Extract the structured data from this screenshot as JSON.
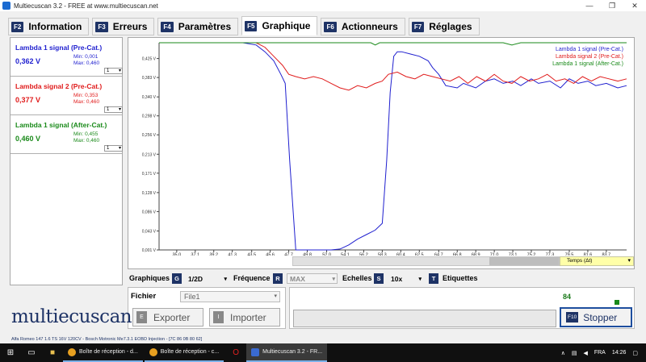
{
  "window": {
    "title": "Multiecuscan 3.2 - FREE at www.multiecuscan.net",
    "controls": [
      "—",
      "❐",
      "✕"
    ]
  },
  "tabs": [
    {
      "key": "F2",
      "label": "Information",
      "active": false
    },
    {
      "key": "F3",
      "label": "Erreurs",
      "active": false
    },
    {
      "key": "F4",
      "label": "Paramètres",
      "active": false
    },
    {
      "key": "F5",
      "label": "Graphique",
      "active": true
    },
    {
      "key": "F6",
      "label": "Actionneurs",
      "active": false
    },
    {
      "key": "F7",
      "label": "Réglages",
      "active": false
    }
  ],
  "signals": [
    {
      "name": "Lambda 1 signal (Pre-Cat.)",
      "value": "0,362 V",
      "min": "Min: 0,001",
      "max": "Max: 0,460",
      "scale": "1",
      "color": "#1f1fcf"
    },
    {
      "name": "Lambda signal 2 (Pre-Cat.)",
      "value": "0,377 V",
      "min": "Min: 0,353",
      "max": "Max: 0,460",
      "scale": "1",
      "color": "#e01b1b"
    },
    {
      "name": "Lambda 1 signal (After-Cat.)",
      "value": "0,460 V",
      "min": "Min: 0,455",
      "max": "Max: 0,460",
      "scale": "1",
      "color": "#1a8a1a"
    }
  ],
  "chart_data": {
    "type": "line",
    "ylim": [
      0.001,
      0.46
    ],
    "xlim": [
      33.0,
      86.0
    ],
    "y_ticks": [
      "0,001 V",
      "0,043 V",
      "0,086 V",
      "0,128 V",
      "0,171 V",
      "0,213 V",
      "0,256 V",
      "0,298 V",
      "0,340 V",
      "0,383 V",
      "0,425 V"
    ],
    "y_tick_values": [
      0.001,
      0.043,
      0.086,
      0.128,
      0.171,
      0.213,
      0.256,
      0.298,
      0.34,
      0.383,
      0.425
    ],
    "x_ticks": [
      "35,0",
      "37,1",
      "39,2",
      "41,3",
      "43,5",
      "45,6",
      "47,7",
      "49,8",
      "52,0",
      "54,1",
      "56,2",
      "58,3",
      "60,4",
      "62,5",
      "64,7",
      "66,8",
      "68,9",
      "71,0",
      "73,1",
      "75,2",
      "77,3",
      "79,5",
      "81,6",
      "83,7"
    ],
    "x_tick_values": [
      35.0,
      37.1,
      39.2,
      41.3,
      43.5,
      45.6,
      47.7,
      49.8,
      52.0,
      54.1,
      56.2,
      58.3,
      60.4,
      62.5,
      64.7,
      66.8,
      68.9,
      71.0,
      73.1,
      75.2,
      77.3,
      79.5,
      81.6,
      83.7
    ],
    "x_axis_menu": "Temps (Δt)",
    "legend_position": "top-right",
    "grid": false,
    "series": [
      {
        "name": "Lambda 1 signal (Pre-Cat.)",
        "color": "#1f1fcf",
        "x": [
          33.0,
          35.0,
          37.0,
          39.0,
          41.0,
          42.5,
          44.0,
          45.0,
          46.0,
          46.8,
          47.3,
          47.8,
          48.5,
          49.5,
          50.5,
          51.5,
          52.5,
          53.5,
          54.5,
          55.5,
          56.5,
          57.5,
          58.3,
          58.8,
          59.2,
          59.6,
          60.0,
          60.5,
          61.5,
          62.5,
          63.5,
          64.0,
          64.7,
          65.5,
          66.8,
          67.5,
          68.9,
          70.0,
          71.0,
          72.0,
          73.1,
          74.0,
          75.2,
          76.0,
          77.3,
          78.5,
          79.5,
          80.5,
          81.6,
          82.5,
          83.7,
          85.0,
          86.0
        ],
        "y": [
          0.46,
          0.46,
          0.46,
          0.46,
          0.46,
          0.46,
          0.455,
          0.44,
          0.42,
          0.39,
          0.37,
          0.2,
          0.001,
          0.001,
          0.001,
          0.001,
          0.001,
          0.003,
          0.012,
          0.025,
          0.035,
          0.045,
          0.06,
          0.2,
          0.35,
          0.43,
          0.44,
          0.44,
          0.435,
          0.43,
          0.42,
          0.405,
          0.39,
          0.365,
          0.36,
          0.37,
          0.36,
          0.375,
          0.38,
          0.37,
          0.375,
          0.365,
          0.38,
          0.37,
          0.375,
          0.36,
          0.38,
          0.37,
          0.375,
          0.365,
          0.37,
          0.36,
          0.365
        ]
      },
      {
        "name": "Lambda signal 2 (Pre-Cat.)",
        "color": "#e01b1b",
        "x": [
          33.0,
          35.0,
          37.0,
          39.0,
          41.0,
          42.5,
          44.0,
          45.0,
          46.0,
          47.0,
          47.7,
          48.5,
          49.5,
          50.5,
          51.5,
          52.5,
          53.5,
          54.5,
          55.5,
          56.5,
          57.5,
          58.3,
          59.0,
          60.0,
          61.0,
          62.0,
          63.0,
          64.0,
          65.0,
          66.0,
          67.0,
          68.0,
          69.0,
          70.0,
          71.0,
          72.0,
          73.0,
          74.0,
          75.0,
          76.0,
          77.0,
          78.0,
          79.0,
          80.0,
          81.0,
          82.0,
          83.0,
          84.0,
          85.0,
          86.0
        ],
        "y": [
          0.46,
          0.46,
          0.46,
          0.46,
          0.46,
          0.46,
          0.46,
          0.45,
          0.43,
          0.41,
          0.39,
          0.385,
          0.38,
          0.385,
          0.38,
          0.37,
          0.36,
          0.355,
          0.365,
          0.36,
          0.37,
          0.375,
          0.39,
          0.395,
          0.385,
          0.38,
          0.39,
          0.385,
          0.38,
          0.375,
          0.385,
          0.37,
          0.385,
          0.375,
          0.39,
          0.375,
          0.37,
          0.385,
          0.375,
          0.38,
          0.39,
          0.375,
          0.38,
          0.37,
          0.385,
          0.375,
          0.385,
          0.38,
          0.375,
          0.38
        ]
      },
      {
        "name": "Lambda 1 signal (After-Cat.)",
        "color": "#1a8a1a",
        "x": [
          33.0,
          38.0,
          43.0,
          48.0,
          52.0,
          56.0,
          57.0,
          57.5,
          58.0,
          62.0,
          66.0,
          70.0,
          72.0,
          73.0,
          74.0,
          78.0,
          82.0,
          86.0
        ],
        "y": [
          0.46,
          0.46,
          0.46,
          0.46,
          0.46,
          0.46,
          0.46,
          0.455,
          0.46,
          0.46,
          0.46,
          0.46,
          0.46,
          0.455,
          0.46,
          0.46,
          0.46,
          0.46
        ]
      }
    ]
  },
  "controls": {
    "graphiques_label": "Graphiques",
    "graphiques_key": "G",
    "graphiques_value": "1/2D",
    "frequence_label": "Fréquence",
    "frequence_key": "R",
    "frequence_value": "MAX",
    "echelles_label": "Echelles",
    "echelles_key": "S",
    "echelles_value": "10x",
    "etiquettes_key": "T",
    "etiquettes_label": "Etiquettes"
  },
  "file": {
    "label": "Fichier",
    "selected": "File1",
    "export_key": "E",
    "export_label": "Exporter",
    "import_key": "I",
    "import_label": "Importer"
  },
  "acquisition": {
    "counter": "84",
    "stop_key": "F10",
    "stop_label": "Stopper",
    "indicator_color": "#1a8a1a"
  },
  "logo": "multiecuscan",
  "status_line": "Alfa Romeo 147 1.6 TS 16V 120CV - Bosch Motronic Me7.3.1 EOBD Injection - [7C 86 0B 80 62]",
  "taskbar": {
    "apps": [
      {
        "label": "Boîte de réception - d...",
        "color": "#e8a020"
      },
      {
        "label": "Boîte de réception - c...",
        "color": "#e8a020"
      },
      {
        "label": "Multiecuscan 3.2 - FR...",
        "color": "#3a6ad1"
      }
    ],
    "language": "FRA",
    "clock": "14:26"
  }
}
